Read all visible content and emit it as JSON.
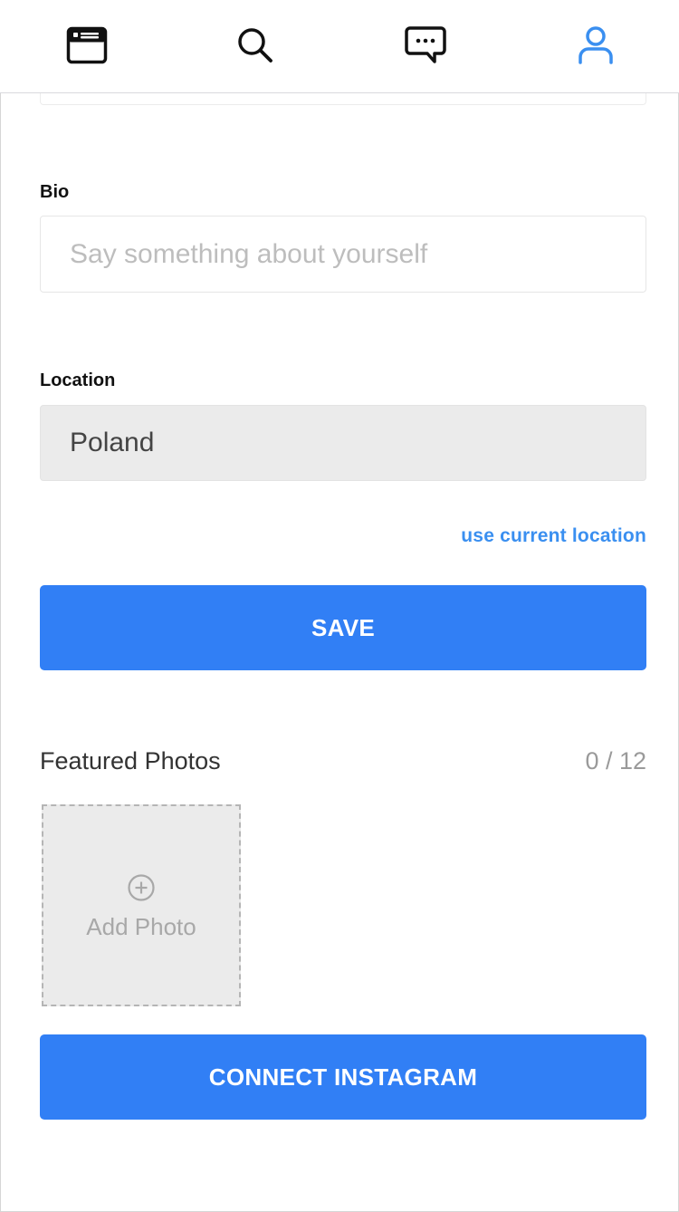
{
  "nav": {
    "items": [
      {
        "icon": "browser-window-icon",
        "active": false
      },
      {
        "icon": "search-icon",
        "active": false
      },
      {
        "icon": "chat-bubble-icon",
        "active": false
      },
      {
        "icon": "user-profile-icon",
        "active": true
      }
    ],
    "active_color": "#3a8ff0",
    "inactive_color": "#111111"
  },
  "bio": {
    "label": "Bio",
    "placeholder": "Say something about yourself",
    "value": ""
  },
  "location": {
    "label": "Location",
    "value": "Poland",
    "use_current_label": "use current location"
  },
  "save_button": {
    "label": "SAVE"
  },
  "featured_photos": {
    "title": "Featured Photos",
    "counter": "0 / 12",
    "add_label": "Add Photo"
  },
  "instagram_button": {
    "label": "CONNECT INSTAGRAM"
  },
  "colors": {
    "primary": "#317ff5",
    "link": "#3a8ff0"
  }
}
